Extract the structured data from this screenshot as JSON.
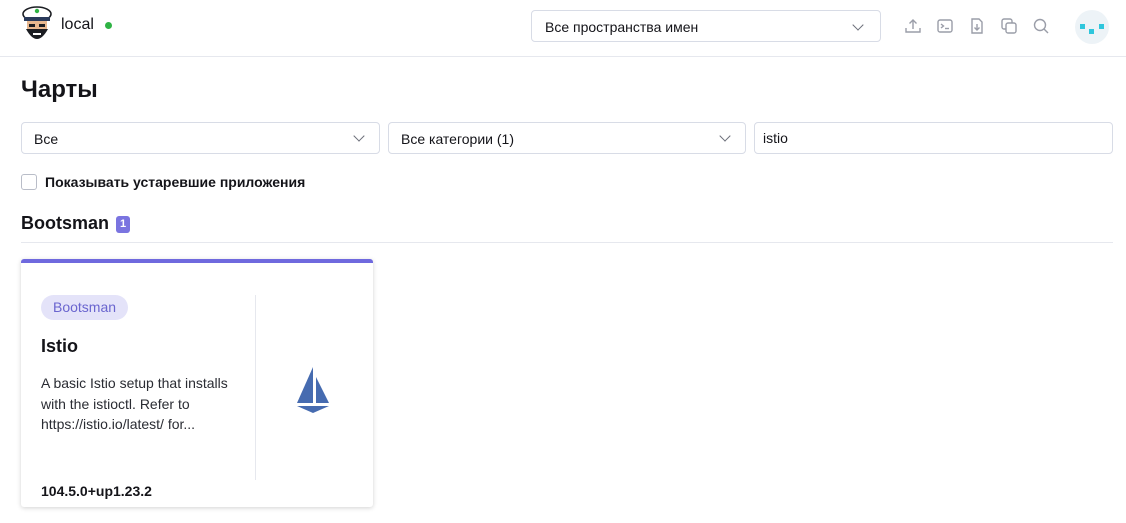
{
  "header": {
    "cluster_name": "local",
    "namespace_select": "Все пространства имен",
    "icons": [
      "upload-icon",
      "terminal-icon",
      "download-icon",
      "copy-icon",
      "search-icon"
    ]
  },
  "page": {
    "title": "Чарты"
  },
  "filters": {
    "repo_select": "Все",
    "category_select": "Все категории (1)",
    "search_value": "istio"
  },
  "show_deprecated": {
    "label": "Показывать устаревшие приложения",
    "checked": false
  },
  "group": {
    "name": "Bootsman",
    "count": "1"
  },
  "cards": [
    {
      "badge": "Bootsman",
      "title": "Istio",
      "description": "A basic Istio setup that installs with the istioctl. Refer to https://istio.io/latest/ for...",
      "version": "104.5.0+up1.23.2",
      "icon": "istio-sail-icon",
      "accent_color": "#6f69de"
    }
  ],
  "colors": {
    "accent": "#6f69de",
    "status_online": "#2fb344",
    "istio_blue": "#466bb0"
  }
}
